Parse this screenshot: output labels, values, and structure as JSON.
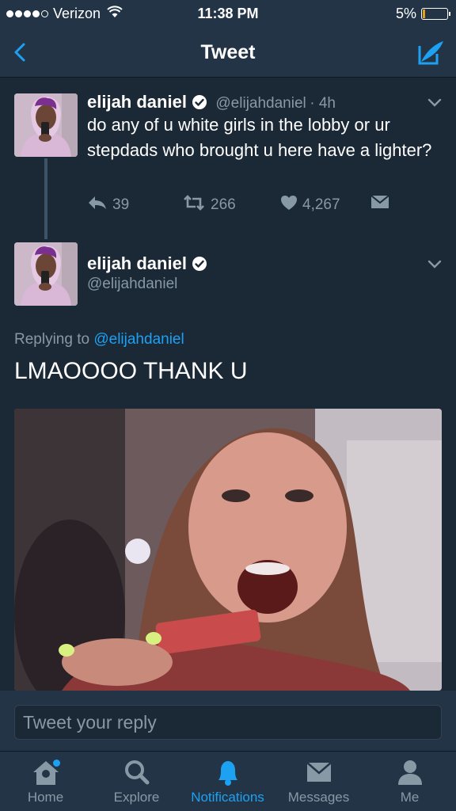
{
  "status": {
    "carrier": "Verizon",
    "time": "11:38 PM",
    "battery": "5%"
  },
  "nav": {
    "title": "Tweet"
  },
  "tweet": {
    "name": "elijah daniel",
    "handle": "@elijahdaniel",
    "age": "· 4h",
    "text": "do any of u white girls in the lobby or ur stepdads who brought u here have a lighter?",
    "replies": "39",
    "retweets": "266",
    "likes": "4,267"
  },
  "reply_tweet": {
    "name": "elijah daniel",
    "handle": "@elijahdaniel",
    "replying_prefix": "Replying to",
    "replying_to": "@elijahdaniel",
    "text": "LMAOOOO THANK U"
  },
  "reply_input": {
    "placeholder": "Tweet your reply"
  },
  "tabs": [
    {
      "label": "Home"
    },
    {
      "label": "Explore"
    },
    {
      "label": "Notifications"
    },
    {
      "label": "Messages"
    },
    {
      "label": "Me"
    }
  ],
  "colors": {
    "accent": "#1da1f2",
    "background": "#1b2836",
    "bar": "#243447",
    "muted": "#8899a6"
  }
}
